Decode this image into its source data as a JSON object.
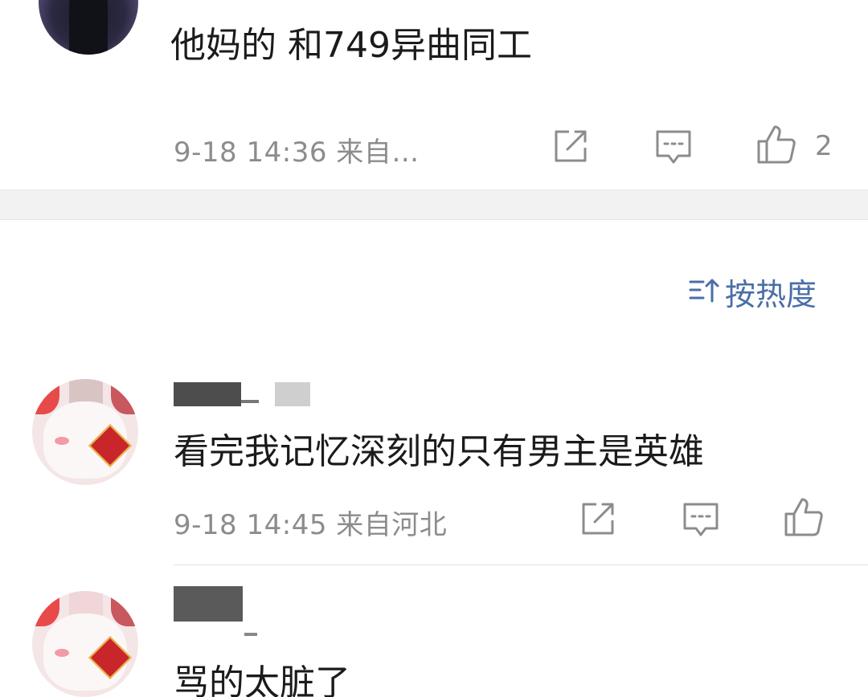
{
  "comments": [
    {
      "text": "他妈的   和749异曲同工",
      "time": "9-18 14:36 来自…",
      "likes": "2",
      "avatar": "dark-photo-avatar"
    },
    {
      "text": "看完我记忆深刻的只有男主是英雄",
      "time": "9-18 14:45 来自河北",
      "likes": "",
      "avatar": "cat-avatar"
    },
    {
      "text": "骂的太脏了",
      "avatar": "cat-avatar"
    }
  ],
  "sort": {
    "label": "按热度",
    "icon": "sort-icon"
  },
  "icons": {
    "share": "share-icon",
    "reply": "comment-icon",
    "like": "thumbs-up-icon"
  },
  "colors": {
    "text": "#1b1b1b",
    "meta": "#8c8c8c",
    "sort_accent": "#4a6ea8",
    "divider": "#f2f2f2"
  }
}
